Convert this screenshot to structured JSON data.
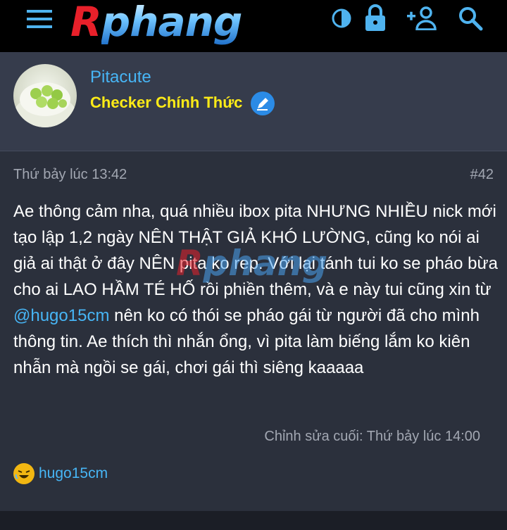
{
  "header": {
    "logo_r": "R",
    "logo_rest": "phang",
    "menu_icon": "hamburger-menu-icon",
    "theme_icon": "contrast-icon",
    "login_icon": "lock-icon",
    "register_icon": "add-person-icon",
    "search_icon": "search-icon"
  },
  "post": {
    "author": "Pitacute",
    "user_title": "Checker Chính Thức",
    "time": "Thứ bảy lúc 13:42",
    "number": "#42",
    "body": {
      "part1": "Ae thông cảm nha, quá nhiều ibox pita NHƯNG NHIỀU nick mới tạo lập 1,2 ngày NÊN THẬT GIẢ KHÓ LƯỜNG, cũng ko nói ai giả ai thật ở đây NÊN pita ko rep. Với lại tánh tui ko se pháo bừa cho ai LAO HẦM TÉ HỐ rồi phiền thêm, và e này tui cũng xin từ ",
      "mention": "@hugo15cm",
      "part2": " nên ko có thói se pháo gái từ người đã cho mình thông tin. Ae thích thì nhắn ổng, vì pita làm biếng lắm ko kiên nhẫn mà ngồi se gái, chơi gái thì siêng kaaaaa"
    },
    "edited": "Chỉnh sửa cuối: Thứ bảy lúc 14:00",
    "reaction_user": "hugo15cm",
    "reaction_icon": "laughing-emoji-icon"
  },
  "colors": {
    "header_bg": "#000000",
    "card_bg": "#2b303c",
    "user_bg": "#363c4c",
    "link": "#47b5f5",
    "title_yellow": "#ffeb17",
    "icon_blue": "#4fb3ef"
  }
}
